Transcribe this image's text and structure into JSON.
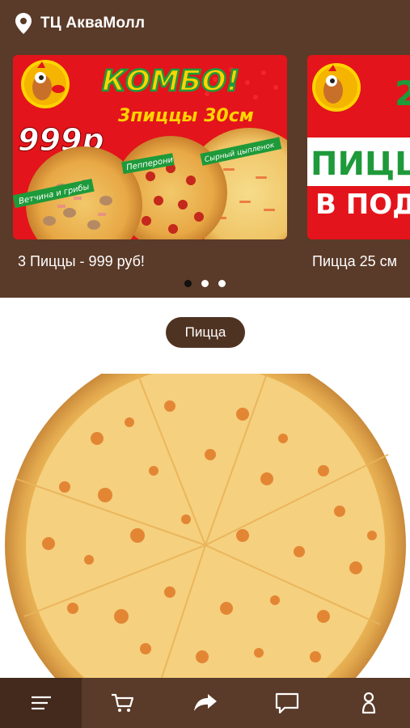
{
  "location": {
    "icon": "location-pin-icon",
    "label": "ТЦ АкваМолл"
  },
  "promos": [
    {
      "headline": "КОМБО!",
      "subheadline": "3пиццы 30см",
      "price": "999р",
      "pizza_labels": [
        "Ветчина и грибы",
        "Пепперони",
        "Сырный цыпленок"
      ],
      "caption": "3 Пиццы - 999 руб!"
    },
    {
      "headline": "2",
      "line1": "ПИЦЦ",
      "line2": "В ПОД",
      "caption": "Пицца 25 см"
    }
  ],
  "carousel": {
    "page_count": 3,
    "active_index": 0
  },
  "category": {
    "label": "Пицца"
  },
  "bottom_nav": [
    {
      "icon": "menu-icon",
      "active": true
    },
    {
      "icon": "cart-icon",
      "active": false
    },
    {
      "icon": "share-icon",
      "active": false
    },
    {
      "icon": "chat-icon",
      "active": false
    },
    {
      "icon": "profile-icon",
      "active": false
    }
  ],
  "colors": {
    "brand_brown": "#5a3a28",
    "pill_brown": "#4f3322",
    "promo_red": "#e3141b",
    "promo_green": "#1e9a3a",
    "promo_yellow": "#ffd400"
  }
}
